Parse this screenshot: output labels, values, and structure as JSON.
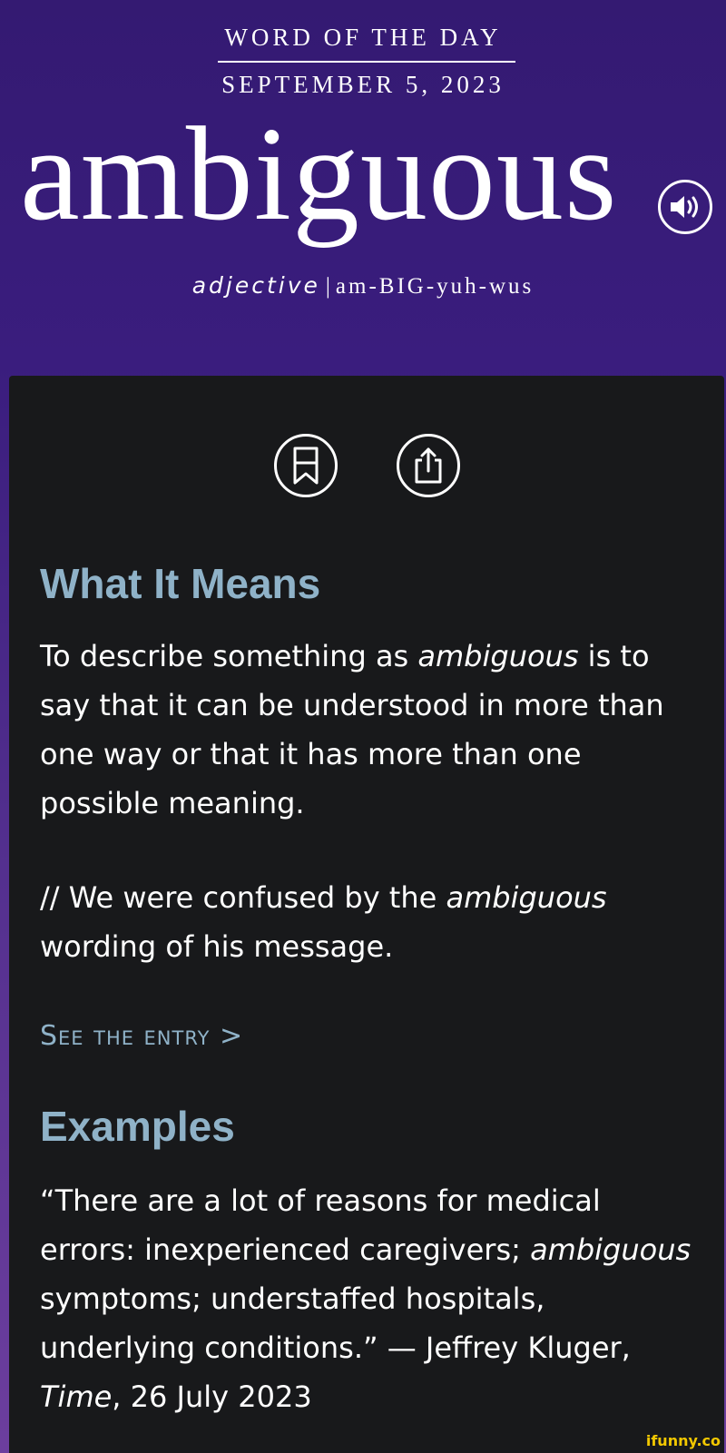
{
  "header": {
    "label": "WORD OF THE DAY",
    "date": "SEPTEMBER 5, 2023",
    "word": "ambiguous",
    "part_of_speech": "adjective",
    "separator": "|",
    "pronunciation": "am-BIG-yuh-wus",
    "audio_icon": "speaker-icon"
  },
  "actions": {
    "bookmark_icon": "bookmark-icon",
    "share_icon": "share-icon"
  },
  "definition": {
    "heading": "What It Means",
    "text_before": "To describe something as ",
    "text_emphasis": "ambiguous",
    "text_after": " is to say that it can be understood in more than one way or that it has more than one possible meaning.",
    "example_before": "// We were confused by the ",
    "example_emphasis": "ambiguous",
    "example_after": " wording of his message.",
    "see_entry": "See the entry >"
  },
  "examples": {
    "heading": "Examples",
    "quote_before": "“There are a lot of reasons for medical errors: inexperienced caregivers; ",
    "quote_emphasis": "ambiguous",
    "quote_after": " symptoms; understaffed hospitals, underlying conditions.” — Jeffrey Kluger, ",
    "source": "Time",
    "date": ", 26 July 2023"
  },
  "watermark": "ifunny.co",
  "colors": {
    "header_bg": "#3a1d7e",
    "card_bg": "#18191b",
    "heading": "#8fb2c8",
    "text": "#ffffff",
    "watermark": "#f2c800"
  }
}
